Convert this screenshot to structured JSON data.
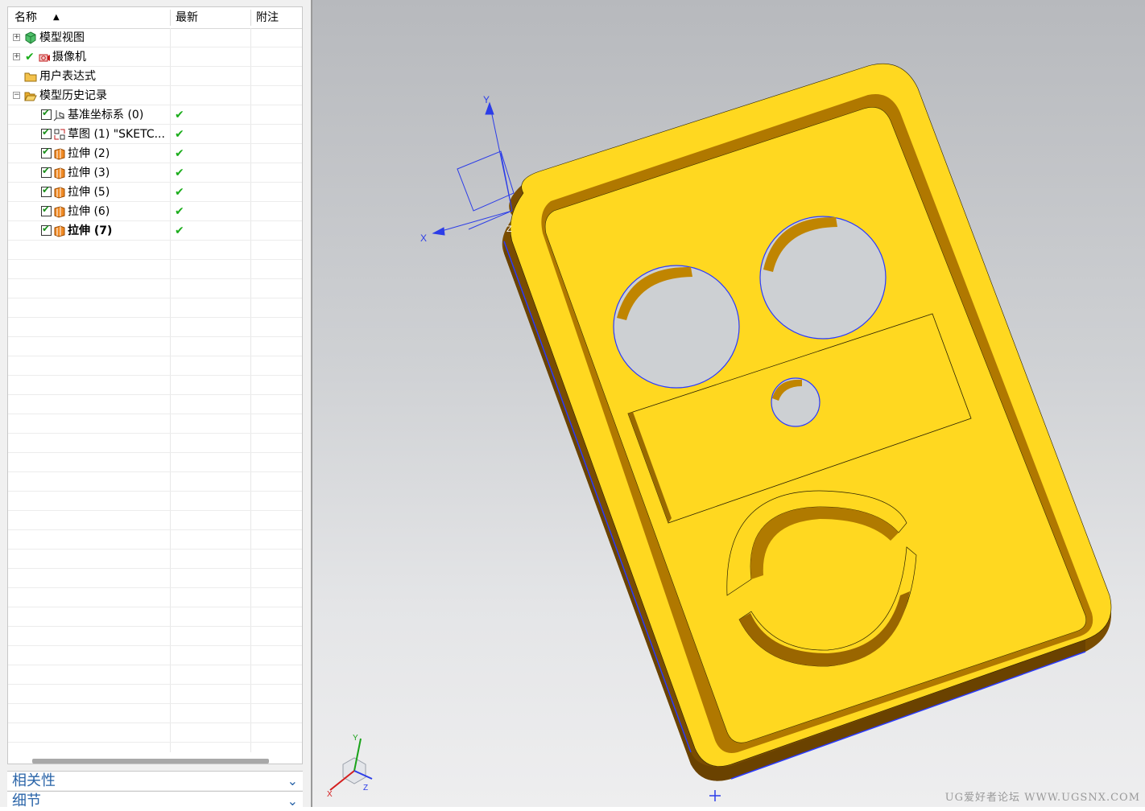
{
  "navigator": {
    "columns": {
      "name": "名称",
      "latest": "最新",
      "comment": "附注"
    },
    "tree": [
      {
        "label": "模型视图",
        "icon": "model-views-icon",
        "checkbox": false,
        "latest": ""
      },
      {
        "label": "摄像机",
        "icon": "camera-icon",
        "checkbox": false,
        "latest": ""
      },
      {
        "label": "用户表达式",
        "icon": "folder-icon",
        "checkbox": false,
        "latest": ""
      },
      {
        "label": "模型历史记录",
        "icon": "folder-open-icon",
        "checkbox": false,
        "latest": ""
      },
      {
        "label": "基准坐标系 (0)",
        "icon": "datum-csys-icon",
        "checkbox": true,
        "latest": "✔"
      },
      {
        "label": "草图 (1) \"SKETC...",
        "icon": "sketch-icon",
        "checkbox": true,
        "latest": "✔"
      },
      {
        "label": "拉伸 (2)",
        "icon": "extrude-icon",
        "checkbox": true,
        "latest": "✔"
      },
      {
        "label": "拉伸 (3)",
        "icon": "extrude-icon",
        "checkbox": true,
        "latest": "✔"
      },
      {
        "label": "拉伸 (5)",
        "icon": "extrude-icon",
        "checkbox": true,
        "latest": "✔"
      },
      {
        "label": "拉伸 (6)",
        "icon": "extrude-icon",
        "checkbox": true,
        "latest": "✔"
      },
      {
        "label": "拉伸 (7)",
        "icon": "extrude-icon",
        "checkbox": true,
        "latest": "✔",
        "bold": true
      }
    ]
  },
  "panels": {
    "dependencies": "相关性",
    "details": "细节"
  },
  "viewport": {
    "csys_labels": {
      "x": "X",
      "y": "Y",
      "z": "Z"
    },
    "triad_labels": {
      "x": "X",
      "y": "Y",
      "z": "Z"
    },
    "part_color": "#ffd820",
    "part_dark": "#8a5a00",
    "watermark": "UG爱好者论坛 WWW.UGSNX.COM"
  }
}
